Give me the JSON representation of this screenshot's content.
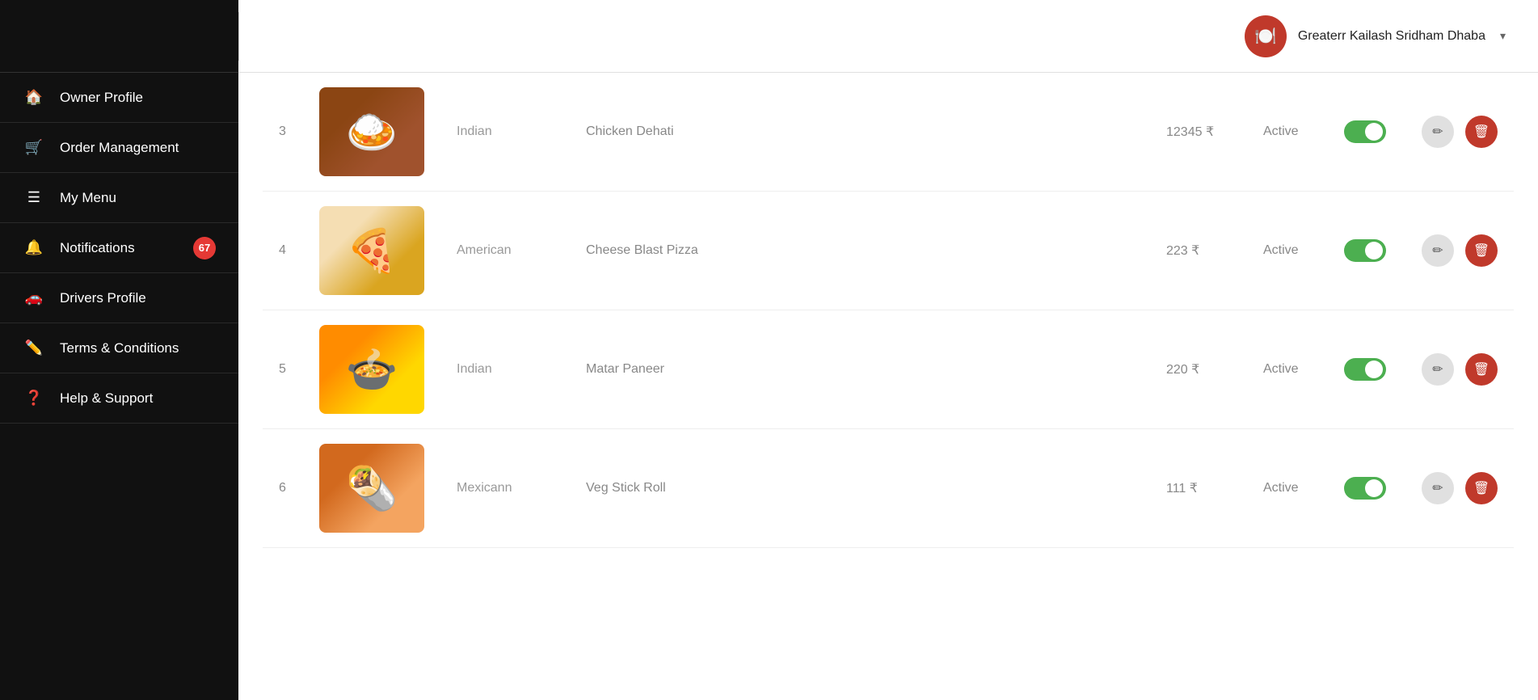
{
  "sidebar": {
    "items": [
      {
        "id": "owner-profile",
        "label": "Owner Profile",
        "icon": "🏠",
        "badge": null
      },
      {
        "id": "order-management",
        "label": "Order Management",
        "icon": "🛒",
        "badge": null
      },
      {
        "id": "my-menu",
        "label": "My Menu",
        "icon": "☰",
        "badge": null
      },
      {
        "id": "notifications",
        "label": "Notifications",
        "icon": "🔔",
        "badge": "67"
      },
      {
        "id": "drivers-profile",
        "label": "Drivers Profile",
        "icon": "🚗",
        "badge": null
      },
      {
        "id": "terms-conditions",
        "label": "Terms & Conditions",
        "icon": "✏️",
        "badge": null
      },
      {
        "id": "help-support",
        "label": "Help & Support",
        "icon": "❓",
        "badge": null
      }
    ]
  },
  "header": {
    "restaurant_name": "Greaterr Kailash Sridham Dhaba",
    "chevron": "▾"
  },
  "menu_items": [
    {
      "num": "3",
      "category": "Indian",
      "name": "Chicken Dehati",
      "price": "12345 ₹",
      "status": "Active",
      "active": true,
      "emoji": "🍛"
    },
    {
      "num": "4",
      "category": "American",
      "name": "Cheese Blast Pizza",
      "price": "223 ₹",
      "status": "Active",
      "active": true,
      "emoji": "🍕"
    },
    {
      "num": "5",
      "category": "Indian",
      "name": "Matar Paneer",
      "price": "220 ₹",
      "status": "Active",
      "active": true,
      "emoji": "🍲"
    },
    {
      "num": "6",
      "category": "Mexicann",
      "name": "Veg Stick Roll",
      "price": "111 ₹",
      "status": "Active",
      "active": true,
      "emoji": "🌯"
    }
  ],
  "actions": {
    "edit_icon": "✏",
    "delete_icon": "🗑"
  }
}
